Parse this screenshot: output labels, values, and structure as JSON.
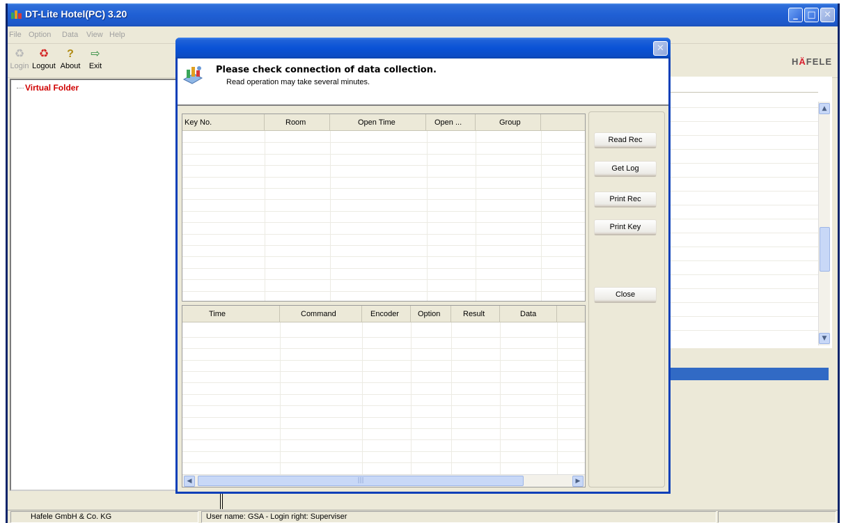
{
  "app": {
    "title": "DT-Lite Hotel(PC) 3.20",
    "menu": [
      "File",
      "Option",
      "Data",
      "View",
      "Help"
    ],
    "toolbar": [
      {
        "label": "Login",
        "icon": "recycle-icon",
        "enabled": false
      },
      {
        "label": "Logout",
        "icon": "recycle-red-icon",
        "enabled": true
      },
      {
        "label": "About",
        "icon": "question-icon",
        "enabled": true
      },
      {
        "label": "Exit",
        "icon": "exit-door-icon",
        "enabled": true
      }
    ],
    "logo": {
      "prefix": "H",
      "accent": "Ä",
      "suffix": "FELE",
      "accent_color": "#d9202f"
    },
    "tree_root": "Virtual Folder",
    "status": {
      "company": "Hafele GmbH & Co. KG",
      "user": "User name: GSA - Login right: Superviser"
    }
  },
  "dialog": {
    "title": "",
    "header_title": "Please check connection of data collection.",
    "header_subtitle": "Read operation may take several  minutes.",
    "records_columns": [
      "Key No.",
      "Room",
      "Open Time",
      "Open ...",
      "Group"
    ],
    "log_columns": [
      "Time",
      "Command",
      "Encoder",
      "Option",
      "Result",
      "Data"
    ],
    "buttons": {
      "read_rec": "Read Rec",
      "get_log": "Get Log",
      "print_rec": "Print Rec",
      "print_key": "Print Key",
      "close": "Close"
    }
  },
  "colors": {
    "title_blue": "#0a52d6",
    "selection_blue": "#316ac5",
    "tree_root_red": "#d00000"
  }
}
